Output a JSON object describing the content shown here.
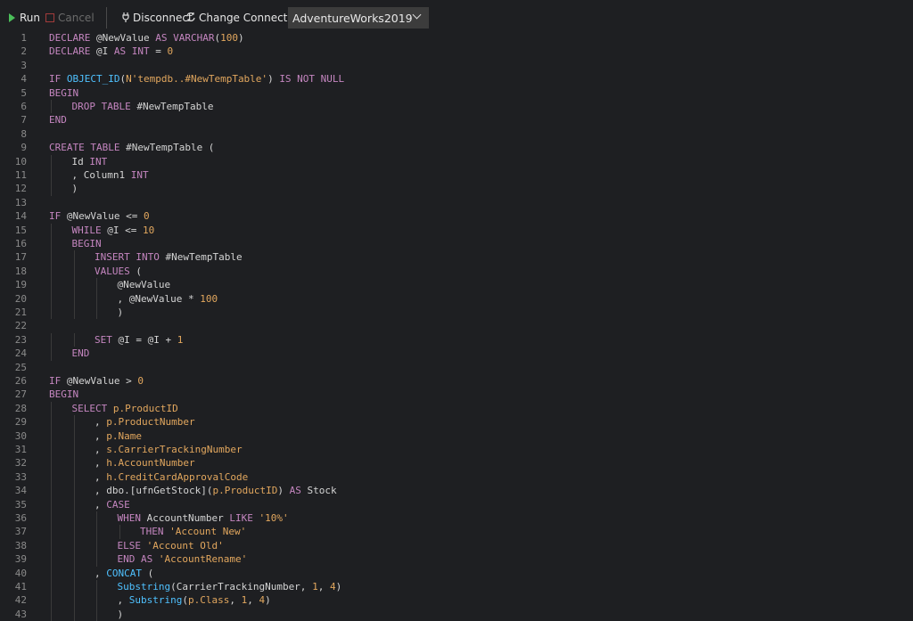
{
  "toolbar": {
    "run_label": "Run",
    "cancel_label": "Cancel",
    "disconnect_label": "Disconnect",
    "change_connection_label": "Change Connection",
    "database": "AdventureWorks2019"
  },
  "code_lines": [
    {
      "n": "1",
      "indent": 0,
      "tokens": [
        [
          "kw",
          "DECLARE "
        ],
        [
          "id",
          "@NewValue "
        ],
        [
          "kw",
          "AS VARCHAR"
        ],
        [
          "op",
          "("
        ],
        [
          "num",
          "100"
        ],
        [
          "op",
          ")"
        ]
      ]
    },
    {
      "n": "2",
      "indent": 0,
      "tokens": [
        [
          "kw",
          "DECLARE "
        ],
        [
          "id",
          "@I "
        ],
        [
          "kw",
          "AS INT "
        ],
        [
          "op",
          "= "
        ],
        [
          "num",
          "0"
        ]
      ]
    },
    {
      "n": "3",
      "indent": 0,
      "tokens": []
    },
    {
      "n": "4",
      "indent": 0,
      "tokens": [
        [
          "kw",
          "IF "
        ],
        [
          "fn",
          "OBJECT_ID"
        ],
        [
          "op",
          "("
        ],
        [
          "str",
          "N'tempdb..#NewTempTable'"
        ],
        [
          "op",
          ") "
        ],
        [
          "kw",
          "IS NOT NULL"
        ]
      ]
    },
    {
      "n": "5",
      "indent": 0,
      "tokens": [
        [
          "kw",
          "BEGIN"
        ]
      ]
    },
    {
      "n": "6",
      "indent": 1,
      "tokens": [
        [
          "kw",
          "DROP TABLE "
        ],
        [
          "id",
          "#NewTempTable"
        ]
      ]
    },
    {
      "n": "7",
      "indent": 0,
      "tokens": [
        [
          "kw",
          "END"
        ]
      ]
    },
    {
      "n": "8",
      "indent": 0,
      "tokens": []
    },
    {
      "n": "9",
      "indent": 0,
      "tokens": [
        [
          "kw",
          "CREATE TABLE "
        ],
        [
          "id",
          "#NewTempTable ("
        ]
      ]
    },
    {
      "n": "10",
      "indent": 1,
      "tokens": [
        [
          "id",
          "Id "
        ],
        [
          "kw",
          "INT"
        ]
      ]
    },
    {
      "n": "11",
      "indent": 1,
      "tokens": [
        [
          "id",
          ", Column1 "
        ],
        [
          "kw",
          "INT"
        ]
      ]
    },
    {
      "n": "12",
      "indent": 1,
      "tokens": [
        [
          "op",
          ")"
        ]
      ]
    },
    {
      "n": "13",
      "indent": 0,
      "tokens": []
    },
    {
      "n": "14",
      "indent": 0,
      "tokens": [
        [
          "kw",
          "IF "
        ],
        [
          "id",
          "@NewValue "
        ],
        [
          "op",
          "<= "
        ],
        [
          "num",
          "0"
        ]
      ]
    },
    {
      "n": "15",
      "indent": 1,
      "tokens": [
        [
          "kw",
          "WHILE "
        ],
        [
          "id",
          "@I "
        ],
        [
          "op",
          "<= "
        ],
        [
          "num",
          "10"
        ]
      ]
    },
    {
      "n": "16",
      "indent": 1,
      "tokens": [
        [
          "kw",
          "BEGIN"
        ]
      ]
    },
    {
      "n": "17",
      "indent": 2,
      "tokens": [
        [
          "kw",
          "INSERT INTO "
        ],
        [
          "id",
          "#NewTempTable"
        ]
      ]
    },
    {
      "n": "18",
      "indent": 2,
      "tokens": [
        [
          "kw",
          "VALUES "
        ],
        [
          "op",
          "("
        ]
      ]
    },
    {
      "n": "19",
      "indent": 3,
      "tokens": [
        [
          "id",
          "@NewValue"
        ]
      ]
    },
    {
      "n": "20",
      "indent": 3,
      "tokens": [
        [
          "id",
          ", @NewValue "
        ],
        [
          "op",
          "* "
        ],
        [
          "num",
          "100"
        ]
      ]
    },
    {
      "n": "21",
      "indent": 3,
      "tokens": [
        [
          "op",
          ")"
        ]
      ]
    },
    {
      "n": "22",
      "indent": 0,
      "tokens": []
    },
    {
      "n": "23",
      "indent": 2,
      "tokens": [
        [
          "kw",
          "SET "
        ],
        [
          "id",
          "@I "
        ],
        [
          "op",
          "= "
        ],
        [
          "id",
          "@I "
        ],
        [
          "op",
          "+ "
        ],
        [
          "num",
          "1"
        ]
      ]
    },
    {
      "n": "24",
      "indent": 1,
      "tokens": [
        [
          "kw",
          "END"
        ]
      ]
    },
    {
      "n": "25",
      "indent": 0,
      "tokens": []
    },
    {
      "n": "26",
      "indent": 0,
      "tokens": [
        [
          "kw",
          "IF "
        ],
        [
          "id",
          "@NewValue "
        ],
        [
          "op",
          "> "
        ],
        [
          "num",
          "0"
        ]
      ]
    },
    {
      "n": "27",
      "indent": 0,
      "tokens": [
        [
          "kw",
          "BEGIN"
        ]
      ]
    },
    {
      "n": "28",
      "indent": 1,
      "tokens": [
        [
          "kw",
          "SELECT "
        ],
        [
          "col",
          "p.ProductID"
        ]
      ]
    },
    {
      "n": "29",
      "indent": 2,
      "tokens": [
        [
          "op",
          ", "
        ],
        [
          "col",
          "p.ProductNumber"
        ]
      ]
    },
    {
      "n": "30",
      "indent": 2,
      "tokens": [
        [
          "op",
          ", "
        ],
        [
          "col",
          "p.Name"
        ]
      ]
    },
    {
      "n": "31",
      "indent": 2,
      "tokens": [
        [
          "op",
          ", "
        ],
        [
          "col",
          "s.CarrierTrackingNumber"
        ]
      ]
    },
    {
      "n": "32",
      "indent": 2,
      "tokens": [
        [
          "op",
          ", "
        ],
        [
          "col",
          "h.AccountNumber"
        ]
      ]
    },
    {
      "n": "33",
      "indent": 2,
      "tokens": [
        [
          "op",
          ", "
        ],
        [
          "col",
          "h.CreditCardApprovalCode"
        ]
      ]
    },
    {
      "n": "34",
      "indent": 2,
      "tokens": [
        [
          "op",
          ", "
        ],
        [
          "id",
          "dbo.[ufnGetStock]("
        ],
        [
          "col",
          "p.ProductID"
        ],
        [
          "id",
          ") "
        ],
        [
          "kw",
          "AS "
        ],
        [
          "id",
          "Stock"
        ]
      ]
    },
    {
      "n": "35",
      "indent": 2,
      "tokens": [
        [
          "op",
          ", "
        ],
        [
          "kw",
          "CASE"
        ]
      ]
    },
    {
      "n": "36",
      "indent": 3,
      "tokens": [
        [
          "kw",
          "WHEN "
        ],
        [
          "id",
          "AccountNumber "
        ],
        [
          "kw",
          "LIKE "
        ],
        [
          "str",
          "'10%'"
        ]
      ]
    },
    {
      "n": "37",
      "indent": 4,
      "tokens": [
        [
          "kw",
          "THEN "
        ],
        [
          "str",
          "'Account New'"
        ]
      ]
    },
    {
      "n": "38",
      "indent": 3,
      "tokens": [
        [
          "kw",
          "ELSE "
        ],
        [
          "str",
          "'Account Old'"
        ]
      ]
    },
    {
      "n": "39",
      "indent": 3,
      "tokens": [
        [
          "kw",
          "END AS "
        ],
        [
          "str",
          "'AccountRename'"
        ]
      ]
    },
    {
      "n": "40",
      "indent": 2,
      "tokens": [
        [
          "op",
          ", "
        ],
        [
          "fn",
          "CONCAT "
        ],
        [
          "op",
          "("
        ]
      ]
    },
    {
      "n": "41",
      "indent": 3,
      "tokens": [
        [
          "fn",
          "Substring"
        ],
        [
          "op",
          "("
        ],
        [
          "id",
          "CarrierTrackingNumber, "
        ],
        [
          "num",
          "1"
        ],
        [
          "op",
          ", "
        ],
        [
          "num",
          "4"
        ],
        [
          "op",
          ")"
        ]
      ]
    },
    {
      "n": "42",
      "indent": 3,
      "tokens": [
        [
          "op",
          ", "
        ],
        [
          "fn",
          "Substring"
        ],
        [
          "op",
          "("
        ],
        [
          "col",
          "p.Class"
        ],
        [
          "op",
          ", "
        ],
        [
          "num",
          "1"
        ],
        [
          "op",
          ", "
        ],
        [
          "num",
          "4"
        ],
        [
          "op",
          ")"
        ]
      ]
    },
    {
      "n": "43",
      "indent": 3,
      "tokens": [
        [
          "op",
          ")"
        ]
      ]
    }
  ]
}
